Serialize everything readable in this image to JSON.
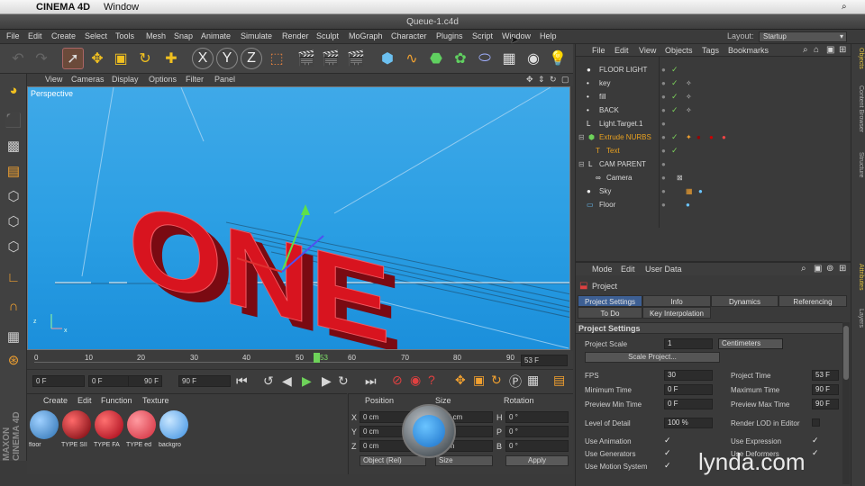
{
  "mac_menu": {
    "app": "CINEMA 4D",
    "window": "Window"
  },
  "title": "Queue-1.c4d",
  "app_menu": [
    "File",
    "Edit",
    "Create",
    "Select",
    "Tools",
    "Mesh",
    "Snap",
    "Animate",
    "Simulate",
    "Render",
    "Sculpt",
    "MoGraph",
    "Character",
    "Plugins",
    "Script",
    "Window",
    "Help"
  ],
  "layout": {
    "label": "Layout:",
    "value": "Startup"
  },
  "viewport": {
    "menu": [
      "View",
      "Cameras",
      "Display",
      "Options",
      "Filter",
      "Panel"
    ],
    "label": "Perspective",
    "text3d": "ONE"
  },
  "timeline": {
    "ticks": [
      "0",
      "10",
      "20",
      "30",
      "40",
      "50",
      "53",
      "60",
      "70",
      "80",
      "90"
    ],
    "current_frame": "53 F"
  },
  "playbar": {
    "start": "0 F",
    "min": "0 F",
    "max": "90 F",
    "end": "90 F"
  },
  "materials": {
    "menu": [
      "Create",
      "Edit",
      "Function",
      "Texture"
    ],
    "items": [
      {
        "label": "floor",
        "color": "#4a8ecf"
      },
      {
        "label": "TYPE SII",
        "color": "#a0101a"
      },
      {
        "label": "TYPE FA",
        "color": "#c8101e"
      },
      {
        "label": "TYPE ed",
        "color": "#e8404e"
      },
      {
        "label": "backgro",
        "color": "#5aa8f0"
      }
    ]
  },
  "coords": {
    "headers": [
      "Position",
      "Size",
      "Rotation"
    ],
    "rows": [
      {
        "axis": "X",
        "pos": "0 cm",
        "size": "175 cm",
        "rot_axis": "H",
        "rot": "0 °"
      },
      {
        "axis": "Y",
        "pos": "0 cm",
        "size": "8 cm",
        "rot_axis": "P",
        "rot": "0 °"
      },
      {
        "axis": "Z",
        "pos": "0 cm",
        "size": "0 cm",
        "rot_axis": "B",
        "rot": "0 °"
      }
    ],
    "mode": "Object (Rel)",
    "size_mode": "Size",
    "apply": "Apply"
  },
  "objects": {
    "menu": [
      "File",
      "Edit",
      "View",
      "Objects",
      "Tags",
      "Bookmarks"
    ],
    "items": [
      {
        "name": "FLOOR LIGHT",
        "indent": 0,
        "highlight": false
      },
      {
        "name": "key",
        "indent": 0,
        "highlight": false
      },
      {
        "name": "fill",
        "indent": 0,
        "highlight": false
      },
      {
        "name": "BACK",
        "indent": 0,
        "highlight": false
      },
      {
        "name": "Light.Target.1",
        "indent": 0,
        "highlight": false
      },
      {
        "name": "Extrude NURBS",
        "indent": 0,
        "highlight": true
      },
      {
        "name": "Text",
        "indent": 1,
        "highlight": true
      },
      {
        "name": "CAM PARENT",
        "indent": 0,
        "highlight": false
      },
      {
        "name": "Camera",
        "indent": 1,
        "highlight": false
      },
      {
        "name": "Sky",
        "indent": 0,
        "highlight": false
      },
      {
        "name": "Floor",
        "indent": 0,
        "highlight": false
      }
    ]
  },
  "attributes": {
    "menu": [
      "Mode",
      "Edit",
      "User Data"
    ],
    "object": "Project",
    "tabs": [
      "Project Settings",
      "Info",
      "Dynamics",
      "Referencing"
    ],
    "tabs2": [
      "To Do",
      "Key Interpolation"
    ],
    "section": "Project Settings",
    "project_scale_label": "Project Scale",
    "project_scale_value": "1",
    "project_scale_unit": "Centimeters",
    "scale_project_btn": "Scale Project...",
    "fps_label": "FPS",
    "fps": "30",
    "project_time_label": "Project Time",
    "project_time": "53 F",
    "min_time_label": "Minimum Time",
    "min_time": "0 F",
    "max_time_label": "Maximum Time",
    "max_time": "90 F",
    "prev_min_label": "Preview Min Time",
    "prev_min": "0 F",
    "prev_max_label": "Preview Max Time",
    "prev_max": "90 F",
    "lod_label": "Level of Detail",
    "lod": "100 %",
    "render_lod_label": "Render LOD in Editor",
    "use_anim_label": "Use Animation",
    "use_expr_label": "Use Expression",
    "use_gen_label": "Use Generators",
    "use_def_label": "Use Deformers",
    "use_motion_label": "Use Motion System"
  },
  "right_tabs": [
    "Objects",
    "Content Browser",
    "Structure",
    "Attributes",
    "Layers"
  ],
  "watermark": "lynda.com",
  "brand": "MAXON CINEMA 4D"
}
